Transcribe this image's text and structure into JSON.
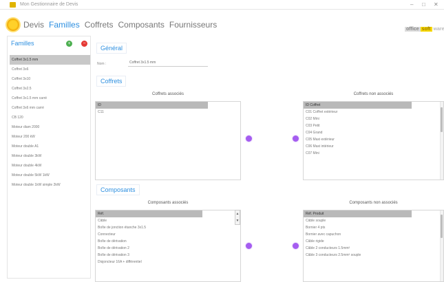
{
  "window": {
    "title": "Mon Gestionnaire de Devis",
    "controls": {
      "minimize": "–",
      "maximize": "□",
      "close": "✕"
    }
  },
  "menu": {
    "items": [
      {
        "label": "Devis"
      },
      {
        "label": "Familles"
      },
      {
        "label": "Coffrets"
      },
      {
        "label": "Composants"
      },
      {
        "label": "Fournisseurs"
      }
    ]
  },
  "logo": {
    "a": "office",
    "b": "soft",
    "c": "ware"
  },
  "families": {
    "header": "Familles",
    "add_glyph": "+",
    "delete_glyph": "−",
    "items": [
      "Coffret 3x1.5 mm",
      "Coffret 3x6",
      "Coffret 3x10",
      "Coffret 3x2.5",
      "Coffret 3x1.5 mm carré",
      "Coffret 3x6 mm carré",
      "CB 120",
      "Moteur diam 2000",
      "Moteur 200 kW",
      "Moteur double A1",
      "Moteur double 3kW",
      "Moteur double 4kW",
      "Moteur double 5kW 1kW",
      "Moteur double 1kW simple 2kW"
    ]
  },
  "general": {
    "section_label": "Général",
    "name_label": "Nom :",
    "name_value": "Coffret 3x1.5 mm"
  },
  "coffrets": {
    "section_label": "Coffrets",
    "associated_title": "Coffrets associés",
    "associated_header": "ID",
    "associated_items": [
      "C11"
    ],
    "unassociated_title": "Coffrets non associés",
    "unassociated_header": "ID Coffret",
    "unassociated_items": [
      "C01 Coffret extérieur",
      "C02 Mini",
      "C03 Petit",
      "C04 Grand",
      "C05 Maxi extérieur",
      "C06 Maxi intérieur",
      "C07 Mini"
    ]
  },
  "composants": {
    "section_label": "Composants",
    "associated_title": "Composants associés",
    "associated_header": "Réf.",
    "associated_items": [
      "Câble",
      "Boîte de jonction étanche 3x1.5",
      "Connecteur",
      "Boîte de dérivation",
      "Boîte de dérivation 2",
      "Boîte de dérivation 3",
      "Disjoncteur 16A + différentiel"
    ],
    "unassociated_title": "Composants non associés",
    "unassociated_header": "Réf. Produit",
    "unassociated_items": [
      "Câble souple",
      "Bornier 4 pts",
      "Bornier avec capuchon",
      "Câble rigide",
      "Câble 2 conducteurs 1.5mm²",
      "Câble 3 conducteurs 2.5mm² souple"
    ]
  }
}
